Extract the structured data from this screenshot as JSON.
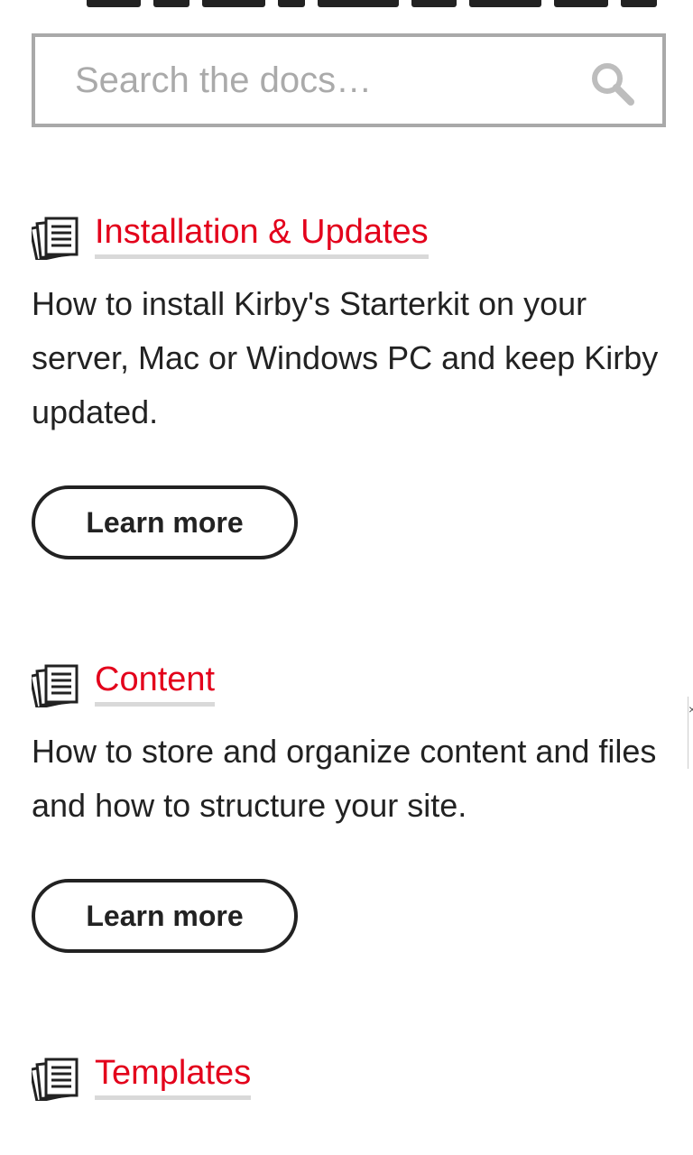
{
  "search": {
    "placeholder": "Search the docs…"
  },
  "sections": [
    {
      "title": "Installation & Updates",
      "description": "How to install Kirby's Starterkit on your server, Mac or Windows PC and keep Kirby updated.",
      "button_label": "Learn more",
      "icon": "document-stack-icon"
    },
    {
      "title": "Content",
      "description": "How to store and organize content and files and how to structure your site.",
      "button_label": "Learn more",
      "icon": "document-stack-icon"
    },
    {
      "title": "Templates",
      "icon": "document-stack-icon"
    }
  ],
  "colors": {
    "accent": "#e3001b",
    "text": "#222222",
    "border": "#a9a9a9",
    "underline": "#d9d9d9"
  },
  "side_widget": {
    "close_glyph": "×"
  }
}
